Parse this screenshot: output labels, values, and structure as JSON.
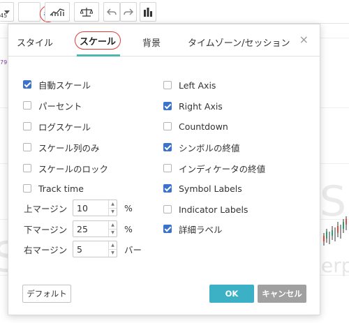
{
  "background": {
    "side_numbers": [
      "45",
      "79"
    ],
    "watermark_letters": [
      "S",
      "S"
    ],
    "watermark_text": "erp"
  },
  "toolbar": {
    "icons": [
      "dropdown-arrow-icon",
      "settings-gear-icon",
      "indicators-icon",
      "compare-icon",
      "undo-icon",
      "redo-icon",
      "bar-chart-icon"
    ]
  },
  "dialog": {
    "tabs": [
      {
        "label": "スタイル",
        "active": false
      },
      {
        "label": "スケール",
        "active": true
      },
      {
        "label": "背景",
        "active": false
      },
      {
        "label": "タイムゾーン/セッション",
        "active": false
      }
    ],
    "close_label": "×",
    "left_options": [
      {
        "label": "自動スケール",
        "checked": true
      },
      {
        "label": "パーセント",
        "checked": false
      },
      {
        "label": "ログスケール",
        "checked": false
      },
      {
        "label": "スケール列のみ",
        "checked": false
      },
      {
        "label": "スケールのロック",
        "checked": false
      },
      {
        "label": "Track time",
        "checked": false
      }
    ],
    "right_options": [
      {
        "label": "Left Axis",
        "checked": false
      },
      {
        "label": "Right Axis",
        "checked": true
      },
      {
        "label": "Countdown",
        "checked": false
      },
      {
        "label": "シンボルの終値",
        "checked": true
      },
      {
        "label": "インディケータの終値",
        "checked": false
      },
      {
        "label": "Symbol Labels",
        "checked": true
      },
      {
        "label": "Indicator Labels",
        "checked": false
      },
      {
        "label": "詳細ラベル",
        "checked": true
      }
    ],
    "margins": [
      {
        "label": "上マージン",
        "value": "10",
        "unit": "%"
      },
      {
        "label": "下マージン",
        "value": "25",
        "unit": "%"
      },
      {
        "label": "右マージン",
        "value": "5",
        "unit": "バー"
      }
    ],
    "stepper_up": "▲",
    "stepper_down": "▼",
    "buttons": {
      "default_label": "デフォルト",
      "ok_label": "OK",
      "cancel_label": "キャンセル"
    }
  },
  "colors": {
    "accent_teal": "#4bb7ad",
    "highlight_red": "#e53935",
    "checkbox_blue": "#3a72cc",
    "ok_button": "#3cb1c6",
    "cancel_button": "#a0a0a0"
  }
}
